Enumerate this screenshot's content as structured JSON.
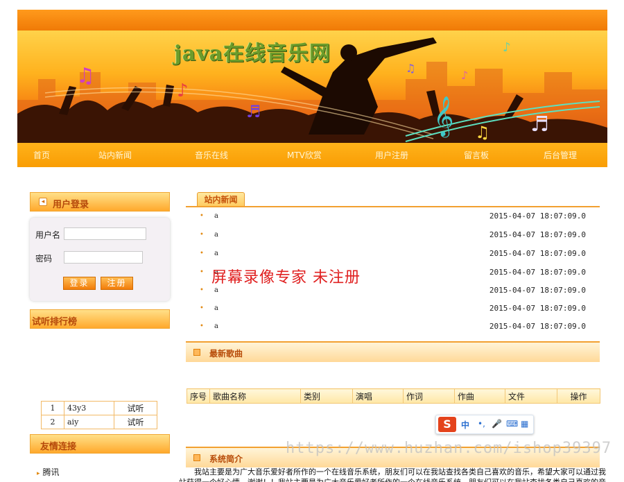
{
  "site": {
    "title": "java在线音乐网"
  },
  "nav": {
    "items": [
      {
        "label": "首页"
      },
      {
        "label": "站内新闻"
      },
      {
        "label": "音乐在线"
      },
      {
        "label": "MTV欣赏"
      },
      {
        "label": "用户注册"
      },
      {
        "label": "留言板"
      },
      {
        "label": "后台管理"
      }
    ]
  },
  "login": {
    "title": "用户登录",
    "username_label": "用户名",
    "username_value": "",
    "password_label": "密码",
    "password_value": "",
    "login_button": "登录",
    "register_button": "注册"
  },
  "ranking": {
    "title": "试听排行榜",
    "rows": [
      {
        "rank": "1",
        "name": "43y3",
        "action": "试听"
      },
      {
        "rank": "2",
        "name": "aiy",
        "action": "试听"
      }
    ]
  },
  "friends": {
    "title": "友情连接",
    "links": [
      "腾讯"
    ]
  },
  "news": {
    "tab_label": "站内新闻",
    "items": [
      {
        "title": "a",
        "date": "2015-04-07 18:07:09.0"
      },
      {
        "title": "a",
        "date": "2015-04-07 18:07:09.0"
      },
      {
        "title": "a",
        "date": "2015-04-07 18:07:09.0"
      },
      {
        "title": "a",
        "date": "2015-04-07 18:07:09.0"
      },
      {
        "title": "a",
        "date": "2015-04-07 18:07:09.0"
      },
      {
        "title": "a",
        "date": "2015-04-07 18:07:09.0"
      },
      {
        "title": "a",
        "date": "2015-04-07 18:07:09.0"
      }
    ]
  },
  "overlay_text": "屏幕录像专家  未注册",
  "songs": {
    "title": "最新歌曲",
    "columns": [
      "序号",
      "歌曲名称",
      "类别",
      "演唱",
      "作词",
      "作曲",
      "文件",
      "操作"
    ]
  },
  "ime": {
    "logo": "S",
    "items": [
      "中",
      "•,",
      "🎤",
      "⌨",
      "▦"
    ]
  },
  "watermark": "https://www.huzhan.com/ishop39397",
  "intro": {
    "title": "系统简介",
    "text": "我站主要是为广大音乐爱好者所作的一个在线音乐系统，朋友们可以在我站查找各类自己喜欢的音乐，希望大家可以通过我站获得一个好心情，谢谢！！我站主要是为广大音乐爱好者所作的一个在线音乐系统，朋友们可以在我站查找各类自己喜欢的音乐，"
  },
  "colors": {
    "accent": "#f99d04",
    "header_text": "#b84d0a"
  }
}
